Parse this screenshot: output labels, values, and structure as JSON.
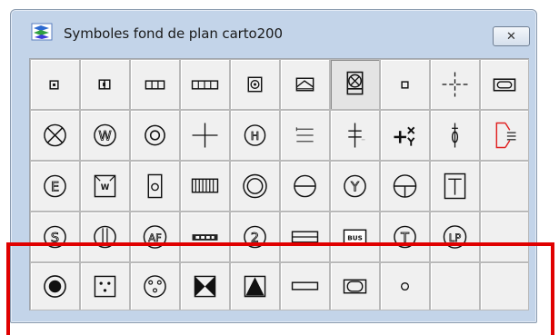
{
  "window": {
    "title": "Symboles fond de plan carto200",
    "close_glyph": "✕"
  },
  "symbols": {
    "row1": [
      "small-square-icon",
      "split-square-icon",
      "double-box-icon",
      "long-box-icon",
      "ring-in-square-icon",
      "gate-hatched-icon",
      "box-cross-icon",
      "tiny-square-icon",
      "dashed-cross-icon",
      "rounded-rect-icon"
    ],
    "row2": [
      "circle-x-icon",
      "circle-w-icon",
      "concentric-circle-icon",
      "plus-icon",
      "circle-h-icon",
      "three-lines-icon",
      "double-cross-icon",
      "plus-x-icon",
      "hydrant-icon",
      "red-bracket-icon"
    ],
    "row3": [
      "circle-e-icon",
      "box-w-icon",
      "box-circle-icon",
      "grill-icon",
      "double-ring-icon",
      "circle-minus-icon",
      "circle-y-icon",
      "circle-plus-icon",
      "box-t-icon",
      "empty-slot-icon"
    ],
    "row4": [
      "circle-s-icon",
      "circle-l-icon",
      "circle-af-icon",
      "label-slab-icon",
      "circle-2-icon",
      "double-rect-icon",
      "bus-box-icon",
      "circle-t-icon",
      "circle-lp-icon",
      "empty-slot-icon"
    ],
    "row5": [
      "filled-dot-ring-icon",
      "socket-box-icon",
      "three-pin-icon",
      "bowtie-icon",
      "triangle-box-icon",
      "bar-rect-icon",
      "box-rect-icon",
      "small-circle-icon",
      "empty-slot-icon",
      "empty-slot-icon"
    ]
  },
  "labels": {
    "bus": "BUS",
    "w": "W",
    "h": "H",
    "e": "E",
    "y": "Y",
    "t": "T",
    "s": "S",
    "af": "AF",
    "two": "2",
    "lp": "LP",
    "plus_x": "+×"
  },
  "colors": {
    "highlight": "#e00000",
    "window_frame": "#c3d4e9"
  }
}
